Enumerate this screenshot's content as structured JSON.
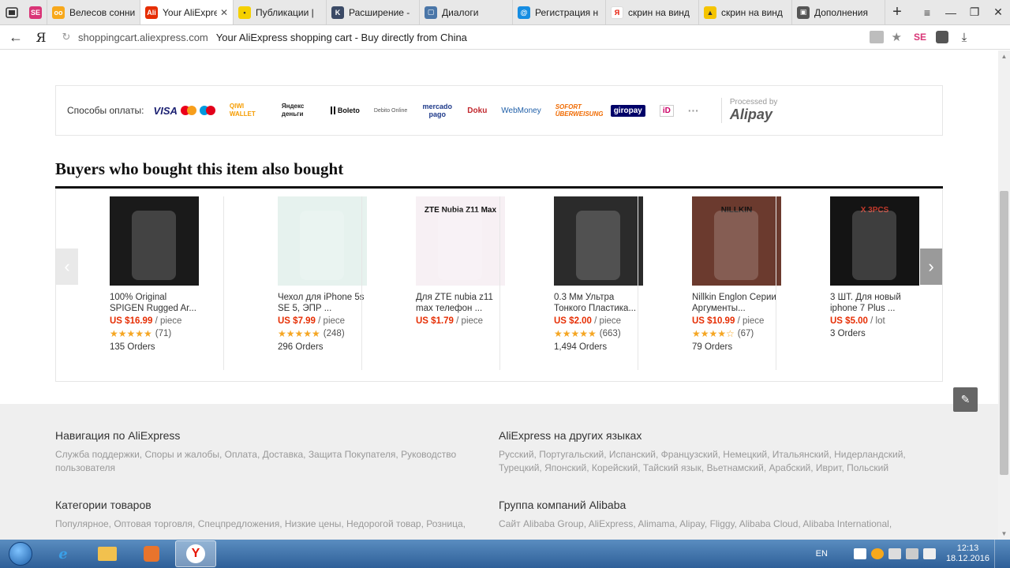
{
  "browser": {
    "tabs": [
      {
        "label": "",
        "fav": "SE",
        "color": "#d93476",
        "pinned": true
      },
      {
        "label": "Велесов сонни",
        "fav": "oo",
        "color": "#f7a81b"
      },
      {
        "label": "Your AliExpre",
        "fav": "Ali",
        "color": "#e62e04",
        "active": true
      },
      {
        "label": "Публикации |",
        "fav": "•",
        "color": "#f5d000"
      },
      {
        "label": "Расширение -",
        "fav": "K",
        "color": "#3b4a66"
      },
      {
        "label": "Диалоги",
        "fav": "▢",
        "color": "#4a76a8"
      },
      {
        "label": "Регистрация н",
        "fav": "@",
        "color": "#168de2"
      },
      {
        "label": "скрин на винд",
        "fav": "Я",
        "color": "#ffffff"
      },
      {
        "label": "скрин на винд",
        "fav": "▲",
        "color": "#f5c400"
      },
      {
        "label": "Дополнения",
        "fav": "▣",
        "color": "#555555"
      }
    ],
    "new_tab": "+",
    "window_controls": {
      "menu": "≡",
      "minimize": "—",
      "restore": "❐",
      "close": "✕"
    },
    "url_domain": "shoppingcart.aliexpress.com",
    "url_title": "Your AliExpress shopping cart - Buy directly from China",
    "yandex_logo": "Я",
    "ext_se": "SE"
  },
  "payment": {
    "label": "Способы оплаты:",
    "methods": {
      "visa": "VISA",
      "qiwi": "QIWI WALLET",
      "yandex": "Яндекс деньги",
      "boleto": "Boleto",
      "debito": "Debito Online",
      "mercado": "mercado pago",
      "doku": "Doku",
      "webmoney": "WebMoney",
      "sofort": "SOFORT ÜBERWEISUNG",
      "giropay": "giropay",
      "ideal": "iD",
      "more": "···"
    },
    "processed_by": "Processed by",
    "alipay": "Alipay"
  },
  "section_title": "Buyers who bought this item also bought",
  "products": [
    {
      "title": "100% Original SPIGEN Rugged Ar...",
      "price": "US $16.99",
      "unit": "/ piece",
      "stars": "★★★★★",
      "reviews": "(71)",
      "orders": "135 Orders",
      "img": "#1a1a1a",
      "img_label": ""
    },
    {
      "title": "Чехол для iPhone 5s SE 5, ЭПР ...",
      "price": "US $7.99",
      "unit": "/ piece",
      "stars": "★★★★★",
      "reviews": "(248)",
      "orders": "296 Orders",
      "img": "#e6f2ee",
      "img_label": ""
    },
    {
      "title": "Для ZTE nubia z11 max телефон ...",
      "price": "US $1.79",
      "unit": "/ piece",
      "stars": "",
      "reviews": "",
      "orders": "",
      "img": "#f7f0f4",
      "img_label": "ZTE Nubia Z11 Max"
    },
    {
      "title": "0.3 Мм Ультра Тонкого Пластика...",
      "price": "US $2.00",
      "unit": "/ piece",
      "stars": "★★★★★",
      "reviews": "(663)",
      "orders": "1,494 Orders",
      "img": "#2b2b2b",
      "img_label": ""
    },
    {
      "title": "Nillkin Englon Серии Аргументы...",
      "price": "US $10.99",
      "unit": "/ piece",
      "stars": "★★★★☆",
      "reviews": "(67)",
      "orders": "79 Orders",
      "img": "#6b3a2e",
      "img_label": "NILLKIN"
    },
    {
      "title": "3 ШТ. Для новый iphone 7 Plus ...",
      "price": "US $5.00",
      "unit": "/ lot",
      "stars": "",
      "reviews": "",
      "orders": "3 Orders",
      "img": "#141414",
      "img_label": "X 3PCS"
    }
  ],
  "carousel": {
    "prev": "‹",
    "next": "›"
  },
  "footer": {
    "nav_title": "Навигация по AliExpress",
    "nav_links": "Служба поддержки, Споры и жалобы, Оплата, Доставка, Защита Покупателя, Руководство пользователя",
    "lang_title": "AliExpress на других языках",
    "lang_links": "Русский, Португальский, Испанский, Французский, Немецкий, Итальянский, Нидерландский, Турецкий, Японский, Корейский, Тайский язык, Вьетнамский, Арабский, Иврит, Польский",
    "cat_title": "Категории товаров",
    "cat_links": "Популярное, Оптовая торговля, Спецпредложения, Низкие цены, Недорогой товар, Розница,",
    "group_title": "Группа компаний Alibaba",
    "group_links": "Сайт Alibaba Group, AliExpress, Alimama, Alipay, Fliggy, Alibaba Cloud, Alibaba International,"
  },
  "taskbar": {
    "lang": "EN",
    "time": "12:13",
    "date": "18.12.2016",
    "yandex_app": "Y"
  }
}
